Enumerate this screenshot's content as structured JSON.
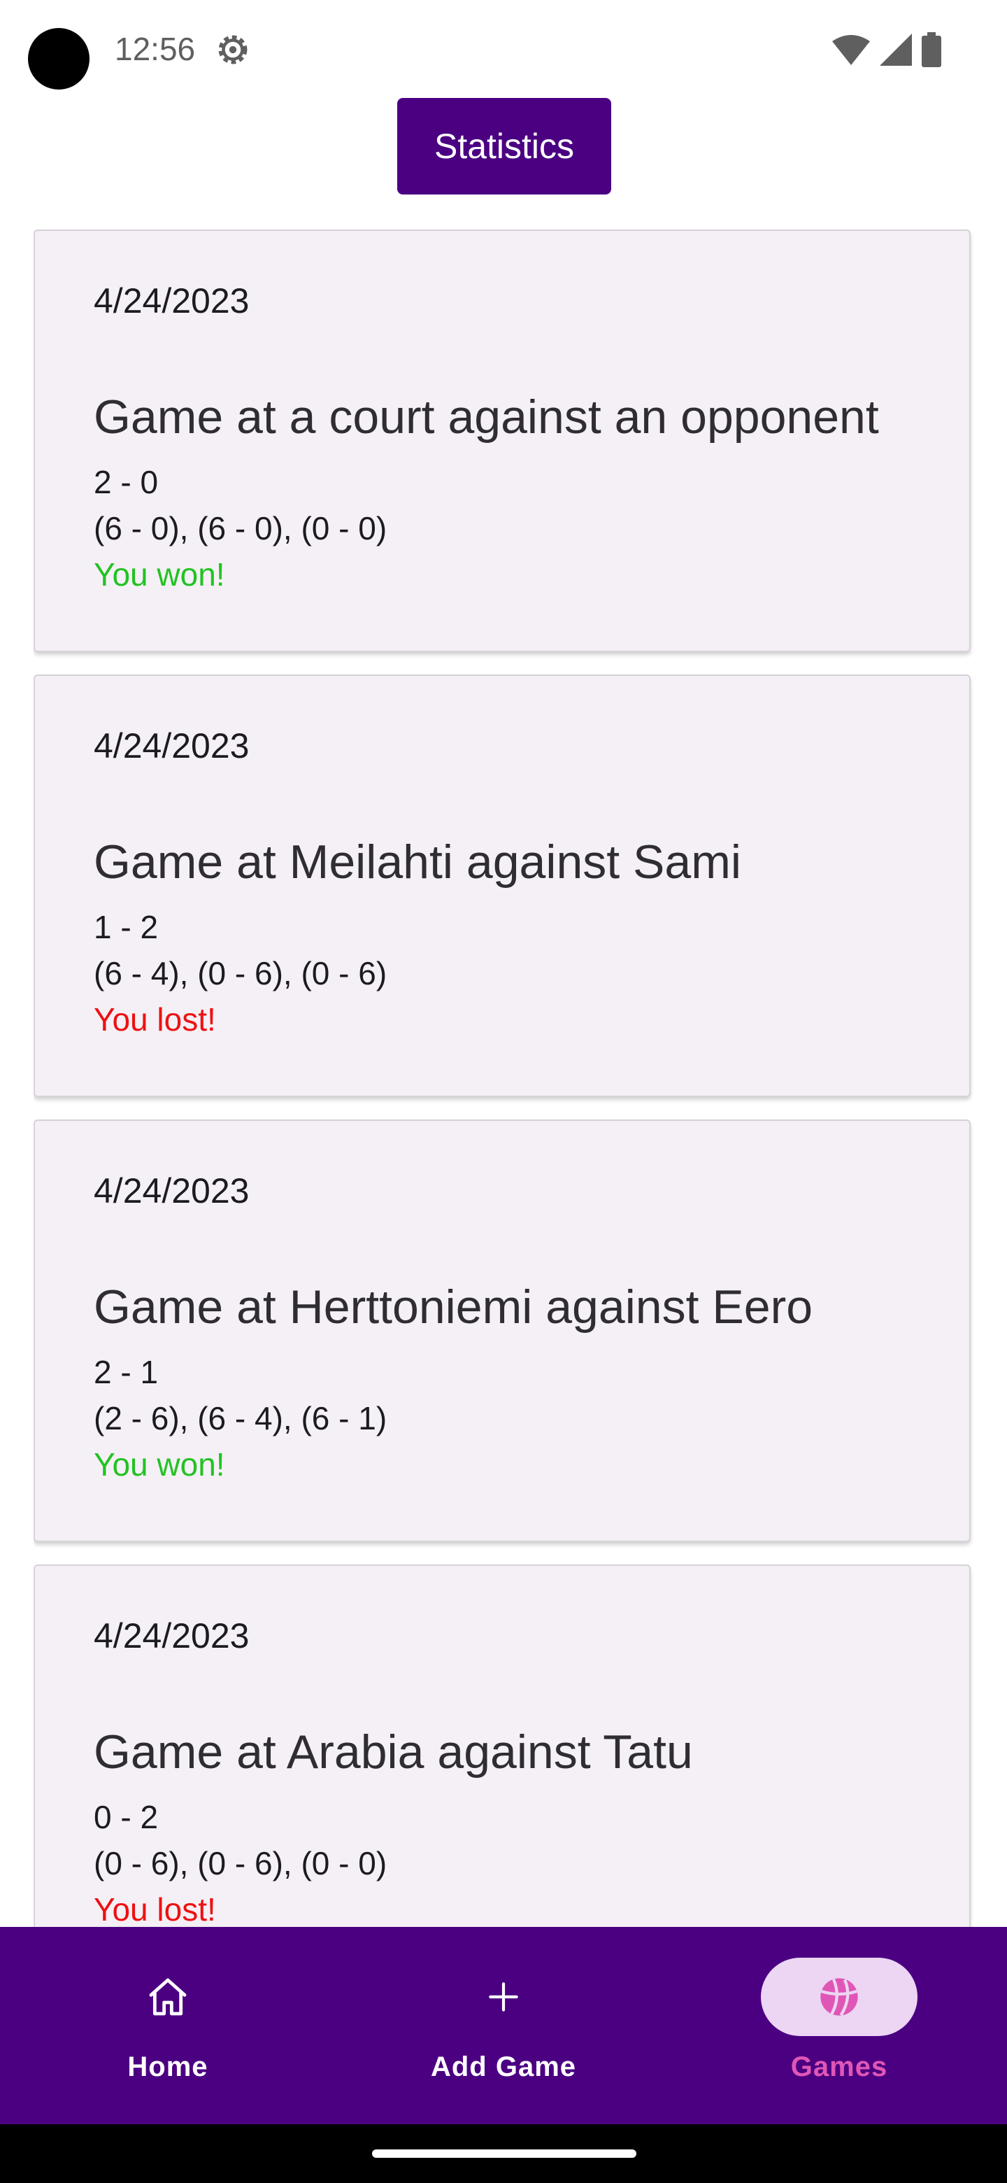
{
  "status_bar": {
    "time": "12:56",
    "icons": [
      "settings-gear-icon",
      "wifi-icon",
      "cellular-signal-icon",
      "battery-icon"
    ]
  },
  "header": {
    "statistics_label": "Statistics"
  },
  "games": [
    {
      "date": "4/24/2023",
      "title": "Game at a court against an opponent",
      "score": "2 - 0",
      "sets": "(6 - 0), (6 - 0), (0 - 0)",
      "result": "You won!",
      "result_color": "#22c322"
    },
    {
      "date": "4/24/2023",
      "title": "Game at Meilahti against Sami",
      "score": "1 - 2",
      "sets": "(6 - 4), (0 - 6), (0 - 6)",
      "result": "You lost!",
      "result_color": "#ee1111"
    },
    {
      "date": "4/24/2023",
      "title": "Game at Herttoniemi against Eero",
      "score": "2 - 1",
      "sets": "(2 - 6), (6 - 4), (6 - 1)",
      "result": "You won!",
      "result_color": "#22c322"
    },
    {
      "date": "4/24/2023",
      "title": "Game at Arabia against Tatu",
      "score": "0 - 2",
      "sets": "(0 - 6), (0 - 6), (0 - 0)",
      "result": "You lost!",
      "result_color": "#ee1111"
    }
  ],
  "bottom_nav": {
    "items": [
      {
        "label": "Home",
        "icon": "home-icon",
        "active": false
      },
      {
        "label": "Add Game",
        "icon": "plus-icon",
        "active": false
      },
      {
        "label": "Games",
        "icon": "ball-icon",
        "active": true
      }
    ]
  },
  "colors": {
    "brand": "#4b0082",
    "card_background": "#f5f0f6",
    "active_nav_pill": "#ecd6f3",
    "active_nav_label": "#e056b6"
  }
}
